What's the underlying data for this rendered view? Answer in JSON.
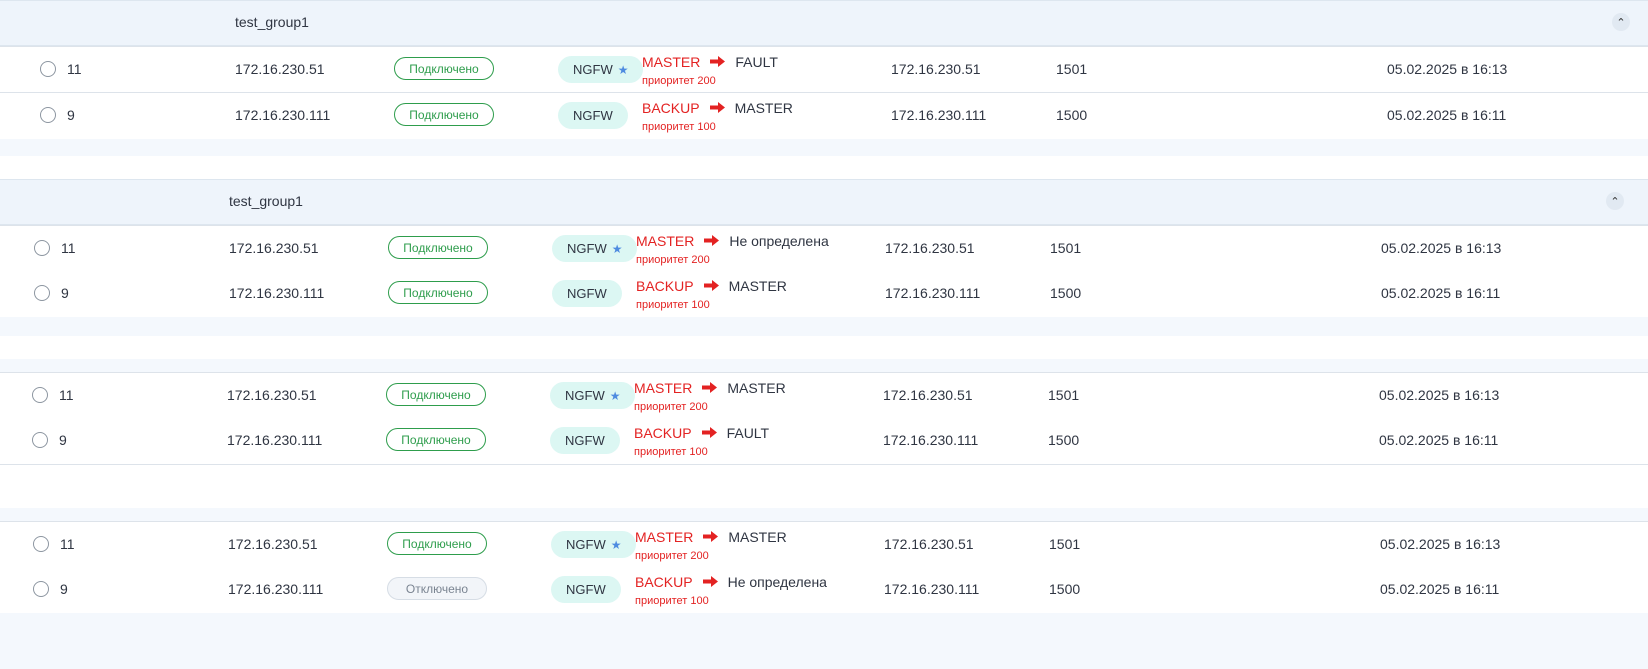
{
  "groups": [
    {
      "name": "test_group1",
      "rows": [
        {
          "id": "11",
          "address": "172.16.230.51",
          "status": "Подключено",
          "status_kind": "on",
          "type": "NGFW",
          "primary": true,
          "from_state": "MASTER",
          "to_state": "FAULT",
          "priority": "приоритет 200",
          "ip": "172.16.230.51",
          "port": "1501",
          "date": "05.02.2025 в 16:13"
        },
        {
          "id": "9",
          "address": "172.16.230.111",
          "status": "Подключено",
          "status_kind": "on",
          "type": "NGFW",
          "primary": false,
          "from_state": "BACKUP",
          "to_state": "MASTER",
          "priority": "приоритет 100",
          "ip": "172.16.230.111",
          "port": "1500",
          "date": "05.02.2025 в 16:11"
        }
      ]
    },
    {
      "name": "test_group1",
      "rows": [
        {
          "id": "11",
          "address": "172.16.230.51",
          "status": "Подключено",
          "status_kind": "on",
          "type": "NGFW",
          "primary": true,
          "from_state": "MASTER",
          "to_state": "Не определена",
          "priority": "приоритет 200",
          "ip": "172.16.230.51",
          "port": "1501",
          "date": "05.02.2025 в 16:13"
        },
        {
          "id": "9",
          "address": "172.16.230.111",
          "status": "Подключено",
          "status_kind": "on",
          "type": "NGFW",
          "primary": false,
          "from_state": "BACKUP",
          "to_state": "MASTER",
          "priority": "приоритет 100",
          "ip": "172.16.230.111",
          "port": "1500",
          "date": "05.02.2025 в 16:11"
        }
      ]
    },
    {
      "name": "",
      "rows": [
        {
          "id": "11",
          "address": "172.16.230.51",
          "status": "Подключено",
          "status_kind": "on",
          "type": "NGFW",
          "primary": true,
          "from_state": "MASTER",
          "to_state": "MASTER",
          "priority": "приоритет 200",
          "ip": "172.16.230.51",
          "port": "1501",
          "date": "05.02.2025 в 16:13"
        },
        {
          "id": "9",
          "address": "172.16.230.111",
          "status": "Подключено",
          "status_kind": "on",
          "type": "NGFW",
          "primary": false,
          "from_state": "BACKUP",
          "to_state": "FAULT",
          "priority": "приоритет 100",
          "ip": "172.16.230.111",
          "port": "1500",
          "date": "05.02.2025 в 16:11"
        }
      ]
    },
    {
      "name": "",
      "rows": [
        {
          "id": "11",
          "address": "172.16.230.51",
          "status": "Подключено",
          "status_kind": "on",
          "type": "NGFW",
          "primary": true,
          "from_state": "MASTER",
          "to_state": "MASTER",
          "priority": "приоритет 200",
          "ip": "172.16.230.51",
          "port": "1501",
          "date": "05.02.2025 в 16:13"
        },
        {
          "id": "9",
          "address": "172.16.230.111",
          "status": "Отключено",
          "status_kind": "off",
          "type": "NGFW",
          "primary": false,
          "from_state": "BACKUP",
          "to_state": "Не определена",
          "priority": "приоритет 100",
          "ip": "172.16.230.111",
          "port": "1500",
          "date": "05.02.2025 в 16:11"
        }
      ]
    }
  ],
  "colors": {
    "accent_red": "#e32222",
    "connected_green": "#2e9d4c",
    "ngfw_bg": "#dcf7f3",
    "star_blue": "#4e8be0"
  },
  "icons": {
    "collapse": "chevron-up-icon",
    "primary": "star-icon",
    "transition": "arrow-right-icon"
  }
}
